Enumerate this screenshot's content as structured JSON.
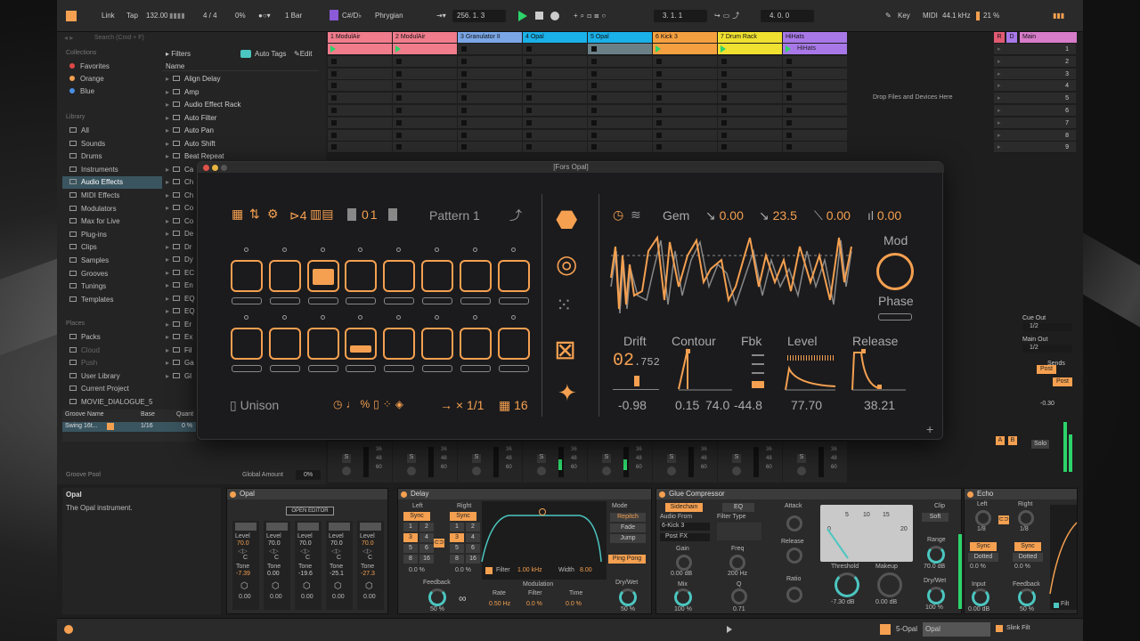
{
  "transport": {
    "link": "Link",
    "tap": "Tap",
    "tempo": "132.00",
    "sig": "4 / 4",
    "swing": "0%",
    "quant": "1 Bar",
    "key": "C#/D♭",
    "scale": "Phrygian",
    "position": "256.  1.  3",
    "loop_start": "3.  1.  1",
    "loop_len": "4.  0.  0",
    "key_label": "Key",
    "midi": "MIDI",
    "samplerate": "44.1 kHz",
    "cpu": "21 %"
  },
  "browser": {
    "search": "Search (Cmd + F)",
    "collections_title": "Collections",
    "collections": [
      "Favorites",
      "Orange",
      "Blue"
    ],
    "collection_colors": [
      "#e04848",
      "#f5a050",
      "#4a8de0"
    ],
    "library_title": "Library",
    "library": [
      "All",
      "Sounds",
      "Drums",
      "Instruments",
      "Audio Effects",
      "MIDI Effects",
      "Modulators",
      "Max for Live",
      "Plug-ins",
      "Clips",
      "Samples",
      "Grooves",
      "Tunings",
      "Templates"
    ],
    "places_title": "Places",
    "places": [
      "Packs",
      "Cloud",
      "Push",
      "User Library",
      "Current Project",
      "MOVIE_DIALOGUE_5"
    ],
    "filters": "Filters",
    "autotags": "Auto Tags",
    "edit": "Edit",
    "name_col": "Name",
    "items": [
      "Align Delay",
      "Amp",
      "Audio Effect Rack",
      "Auto Filter",
      "Auto Pan",
      "Auto Shift",
      "Beat Repeat",
      "Ca",
      "Ch",
      "Ch",
      "Co",
      "Co",
      "De",
      "Dr",
      "Dy",
      "EC",
      "En",
      "EQ",
      "EQ",
      "Er",
      "Ex",
      "Fil",
      "Ga",
      "Gl"
    ],
    "groove_head": {
      "name": "Groove Name",
      "base": "Base",
      "quant": "Quant"
    },
    "groove_row": {
      "name": "Swing 16t...",
      "base": "1/16",
      "quant": "0 %"
    },
    "groove_pool": "Groove Pool",
    "global_amount": "Global Amount",
    "global_val": "0%"
  },
  "tracks": [
    {
      "name": "1 ModulAir",
      "color": "#f07c8c"
    },
    {
      "name": "2 ModulAir",
      "color": "#f07c8c"
    },
    {
      "name": "3 Granulator II",
      "color": "#7aa6e6"
    },
    {
      "name": "4 Opal",
      "color": "#1ab0e8"
    },
    {
      "name": "5 Opal",
      "color": "#1ab0e8"
    },
    {
      "name": "6 Kick 3",
      "color": "#f5a040"
    },
    {
      "name": "7 Drum Rack",
      "color": "#f0e030"
    },
    {
      "name": "HiHats",
      "color": "#a878e8"
    }
  ],
  "hihats_clip": "HiHats",
  "drop_text": "Drop Files and Devices Here",
  "master": {
    "r": "R",
    "d": "D",
    "name": "Main",
    "scenes": [
      "1",
      "2",
      "3",
      "4",
      "5",
      "6",
      "7",
      "8",
      "9"
    ],
    "cue_out": "Cue Out",
    "cue_val": "1/2",
    "main_out": "Main Out",
    "main_val": "1/2",
    "sends": "Sends",
    "post1": "Post",
    "post2": "Post",
    "vol": "-0.30",
    "solo": "Solo"
  },
  "editor": {
    "title": "[Fors Opal]",
    "voices": "4",
    "pattern_num": "01",
    "pattern": "Pattern 1",
    "unison": "Unison",
    "rate": "1/1",
    "steps": "16",
    "engine": "Gem",
    "p1": "0.00",
    "p2": "23.5",
    "p3": "0.00",
    "p4": "0.00",
    "mod": "Mod",
    "phase": "Phase",
    "params": [
      "Drift",
      "Contour",
      "Fbk",
      "Level",
      "Release"
    ],
    "drift_digits": "02",
    "drift_small": ".752",
    "values": [
      "-0.98",
      "0.15",
      "74.0",
      "-44.8",
      "77.70",
      "38.21"
    ]
  },
  "info": {
    "title": "Opal",
    "desc": "The Opal instrument."
  },
  "opal": {
    "title": "Opal",
    "open_editor": "OPEN EDITOR",
    "cols": [
      {
        "level": "70.0",
        "tone": "-7.39",
        "bottom": "0.00"
      },
      {
        "level": "70.0",
        "tone": "0.00",
        "bottom": "0.00"
      },
      {
        "level": "70.0",
        "tone": "-19.6",
        "bottom": "0.00"
      },
      {
        "level": "70.0",
        "tone": "-25.1",
        "bottom": "0.00"
      },
      {
        "level": "70.0",
        "tone": "-27.3",
        "bottom": "0.00"
      }
    ],
    "level_lbl": "Level",
    "tone_lbl": "Tone",
    "c": "C"
  },
  "delay": {
    "title": "Delay",
    "left": "Left",
    "right": "Right",
    "sync": "Sync",
    "grid": [
      "1",
      "2",
      "3",
      "4",
      "5",
      "6",
      "8",
      "16"
    ],
    "pct": "0.0 %",
    "feedback": "Feedback",
    "fb_val": "50 %",
    "filter": "Filter",
    "freq": "1.00 kHz",
    "width": "Width",
    "width_val": "8.00",
    "modulation": "Modulation",
    "rate": "Rate",
    "rate_val": "0.50 Hz",
    "filt": "Filter",
    "filt_val": "0.0 %",
    "time": "Time",
    "time_val": "0.0 %",
    "mode": "Mode",
    "modes": [
      "Repitch",
      "Fade",
      "Jump"
    ],
    "pingpong": "Ping Pong",
    "drywet": "Dry/Wet",
    "dw_val": "50 %"
  },
  "comp": {
    "title": "Glue Compressor",
    "sidechain": "Sidechain",
    "eq": "EQ",
    "audio_from": "Audio From",
    "src": "6-Kick 3",
    "postfx": "Post FX",
    "filter_type": "Filter Type",
    "gain": "Gain",
    "gain_val": "0.00 dB",
    "freq": "Freq",
    "freq_val": "200 Hz",
    "mix": "Mix",
    "mix_val": "100 %",
    "q": "Q",
    "q_val": "0.71",
    "attack": "Attack",
    "release": "Release",
    "ratio": "Ratio",
    "threshold": "Threshold",
    "thr_val": "-7.30 dB",
    "makeup": "Makeup",
    "mk_val": "0.00 dB",
    "clip": "Clip",
    "soft": "Soft",
    "range": "Range",
    "range_val": "70.0 dB",
    "drywet": "Dry/Wet",
    "dw_val": "100 %",
    "meter": [
      "0",
      "5",
      "10",
      "15",
      "20"
    ]
  },
  "echo": {
    "title": "Echo",
    "left": "Left",
    "right": "Right",
    "l_val": "1/8",
    "r_val": "1/8",
    "sync": "Sync",
    "dotted": "Dotted",
    "pct": "0.0 %",
    "input": "Input",
    "input_val": "0.00 dB",
    "feedback": "Feedback",
    "fb_val": "50 %",
    "filter": "Filt"
  },
  "status": {
    "track": "5-Opal",
    "clip": "Opal",
    "device": "Slink Filt"
  }
}
